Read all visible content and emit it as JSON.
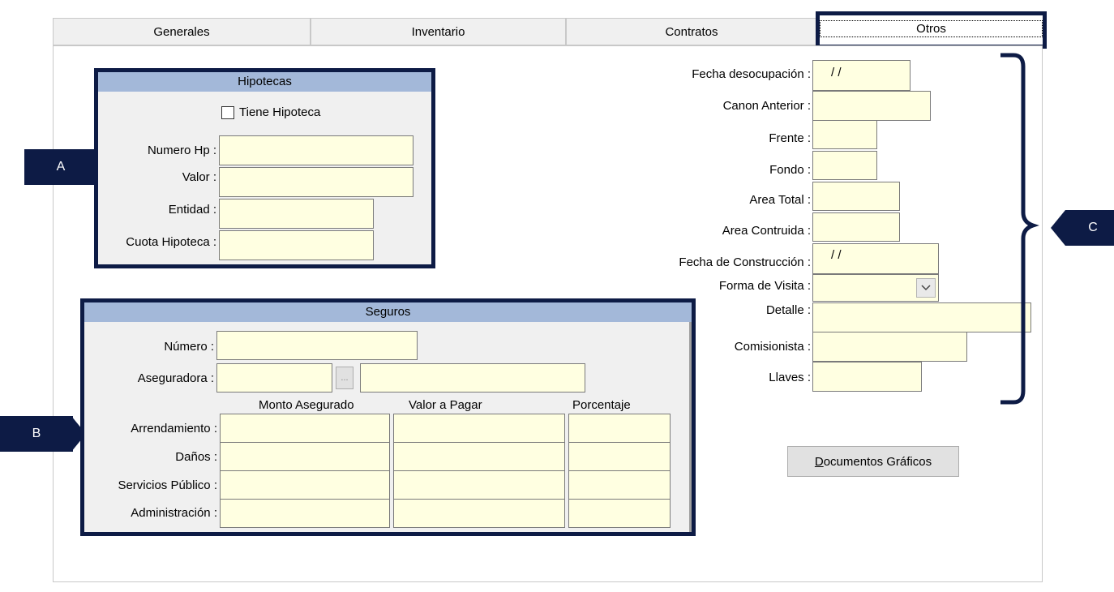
{
  "tabs": [
    {
      "label": "Generales"
    },
    {
      "label": "Inventario"
    },
    {
      "label": "Contratos"
    },
    {
      "label": "Otros"
    }
  ],
  "markers": {
    "a": "A",
    "b": "B",
    "c": "C"
  },
  "hipotecas": {
    "title": "Hipotecas",
    "checkbox_label": "Tiene Hipoteca",
    "checked": false,
    "numero_label": "Numero Hp :",
    "valor_label": "Valor :",
    "entidad_label": "Entidad :",
    "cuota_label": "Cuota Hipoteca :"
  },
  "seguros": {
    "title": "Seguros",
    "numero_label": "Número :",
    "aseguradora_label": "Aseguradora :",
    "browse_label": "...",
    "columns": [
      "Monto Asegurado",
      "Valor a Pagar",
      "Porcentaje"
    ],
    "rows": [
      "Arrendamiento :",
      "Daños :",
      "Servicios Público :",
      "Administración :"
    ]
  },
  "otros": {
    "fecha_desocupacion_label": "Fecha desocupación :",
    "fecha_desocupacion_value": " / /",
    "canon_anterior_label": "Canon Anterior :",
    "frente_label": "Frente :",
    "fondo_label": "Fondo :",
    "area_total_label": "Area Total :",
    "area_contruida_label": "Area Contruida :",
    "fecha_construccion_label": "Fecha de Construcción :",
    "fecha_construccion_value": " / /",
    "forma_visita_label": "Forma de Visita :",
    "detalle_label": "Detalle :",
    "comisionista_label": "Comisionista :",
    "llaves_label": "Llaves :",
    "documentos_button_accel": "D",
    "documentos_button_rest": "ocumentos Gráficos"
  }
}
